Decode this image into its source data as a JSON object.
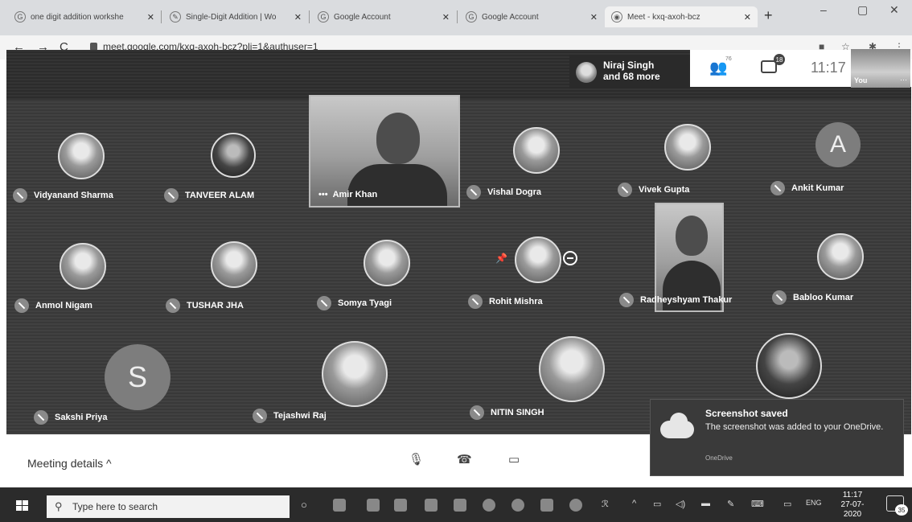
{
  "browser": {
    "tabs": [
      {
        "icon": "G",
        "label": "one digit addition workshe"
      },
      {
        "icon": "✎",
        "label": "Single-Digit Addition | Wo"
      },
      {
        "icon": "G",
        "label": "Google Account"
      },
      {
        "icon": "G",
        "label": "Google Account"
      },
      {
        "icon": "◉",
        "label": "Meet - kxq-axoh-bcz"
      }
    ],
    "tab_close": "✕",
    "new_tab": "+",
    "url": "meet.google.com/kxq-axoh-bcz?pli=1&authuser=1",
    "window_controls": [
      "–",
      "▢",
      "✕"
    ]
  },
  "meet": {
    "presenter": {
      "name": "Niraj Singh",
      "more": "and 68 more"
    },
    "people_count": "76",
    "chat_badge": "18",
    "time": "11:17",
    "self_label": "You",
    "self_more": "⋯",
    "tile_menu": "•••",
    "participants": [
      {
        "name": "Vidyanand Sharma"
      },
      {
        "name": "TANVEER ALAM"
      },
      {
        "name": "Amir Khan"
      },
      {
        "name": "Vishal Dogra"
      },
      {
        "name": "Vivek Gupta"
      },
      {
        "name": "Ankit Kumar",
        "initial": "A"
      },
      {
        "name": "Anmol Nigam"
      },
      {
        "name": "TUSHAR JHA"
      },
      {
        "name": "Somya Tyagi"
      },
      {
        "name": "Rohit Mishra"
      },
      {
        "name": "Radheyshyam Thakur"
      },
      {
        "name": "Babloo Kumar"
      },
      {
        "name": "Sakshi Priya",
        "initial": "S"
      },
      {
        "name": "Tejashwi Raj"
      },
      {
        "name": "NITIN SINGH"
      }
    ],
    "controls": {
      "meeting_details": "Meeting details ^"
    }
  },
  "toast": {
    "title": "Screenshot saved",
    "body": "The screenshot was added to your OneDrive.",
    "source": "OneDrive"
  },
  "taskbar": {
    "search_placeholder": "Type here to search",
    "lang": "ENG",
    "time": "11:17",
    "date": "27-07-2020",
    "notif_count": "35"
  }
}
